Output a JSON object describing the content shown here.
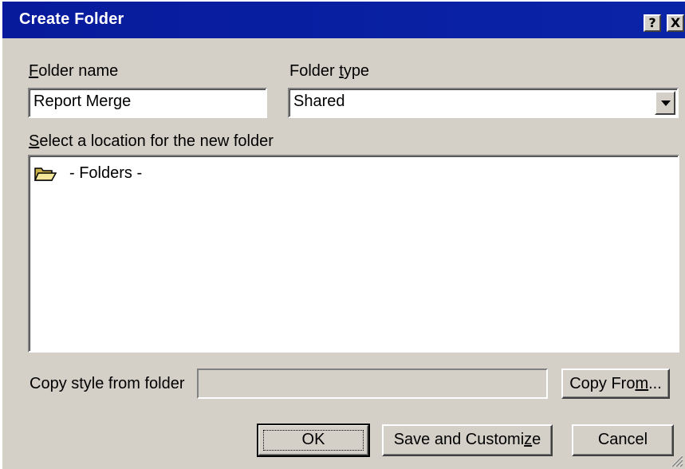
{
  "window": {
    "title": "Create Folder"
  },
  "titlebar_buttons": {
    "help": "?",
    "close": "X"
  },
  "folder_name": {
    "label_accel": "F",
    "label_rest": "older name",
    "value": "Report Merge"
  },
  "folder_type": {
    "label_pre": "Folder ",
    "label_accel": "t",
    "label_rest": "ype",
    "selected": "Shared"
  },
  "location": {
    "label_accel": "S",
    "label_rest": "elect a location for the new folder",
    "tree": [
      {
        "label": "- Folders -",
        "icon": "open-folder-icon"
      }
    ]
  },
  "copy_style": {
    "label": "Copy style from folder",
    "value": "",
    "button_pre": "Copy Fro",
    "button_accel": "m",
    "button_rest": "..."
  },
  "buttons": {
    "ok": "OK",
    "save_pre": "Save and Customi",
    "save_accel": "z",
    "save_rest": "e",
    "cancel": "Cancel"
  },
  "colors": {
    "titlebar": "#0a24a8",
    "face": "#d4d0c8"
  }
}
